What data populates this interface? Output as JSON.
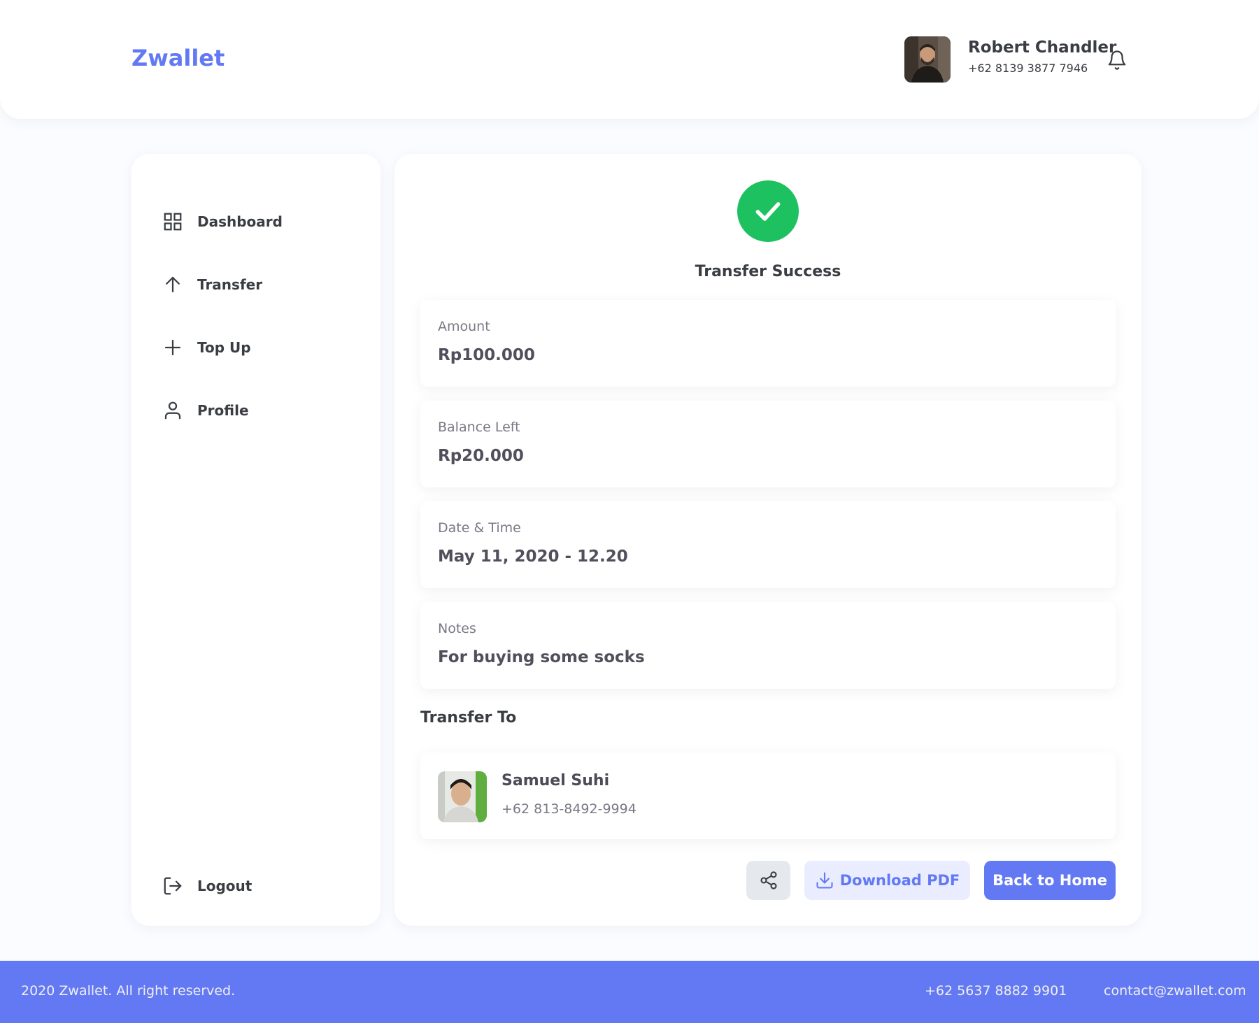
{
  "header": {
    "brand": "Zwallet",
    "user_name": "Robert Chandler",
    "user_phone": "+62 8139 3877 7946"
  },
  "sidebar": {
    "items": [
      {
        "label": "Dashboard",
        "icon": "grid-icon"
      },
      {
        "label": "Transfer",
        "icon": "arrow-up-icon"
      },
      {
        "label": "Top Up",
        "icon": "plus-icon"
      },
      {
        "label": "Profile",
        "icon": "user-icon"
      }
    ],
    "logout_label": "Logout"
  },
  "main": {
    "status_title": "Transfer Success",
    "details": [
      {
        "label": "Amount",
        "value": "Rp100.000"
      },
      {
        "label": "Balance Left",
        "value": "Rp20.000"
      },
      {
        "label": "Date & Time",
        "value": "May 11, 2020 - 12.20"
      },
      {
        "label": "Notes",
        "value": "For buying some socks"
      }
    ],
    "transfer_to_title": "Transfer To",
    "recipient": {
      "name": "Samuel Suhi",
      "phone": "+62 813-8492-9994"
    },
    "download_label": "Download PDF",
    "home_label": "Back to Home"
  },
  "footer": {
    "copyright": "2020 Zwallet. All right reserved.",
    "phone": "+62 5637 8882 9901",
    "email": "contact@zwallet.com"
  },
  "colors": {
    "primary": "#6379F4",
    "success": "#1EC15F",
    "background": "#FAFCFF"
  }
}
